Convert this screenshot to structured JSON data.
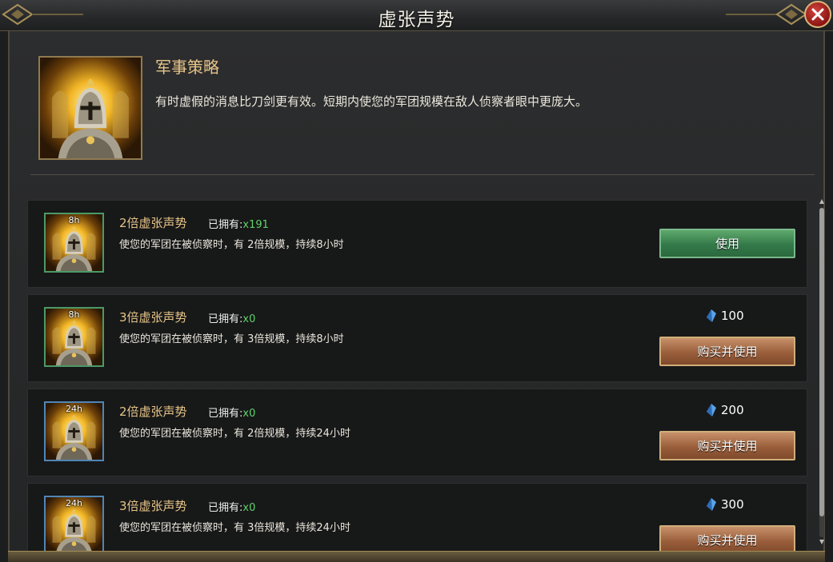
{
  "window": {
    "title": "虚张声势",
    "close_icon": "close-icon"
  },
  "header": {
    "title": "军事策略",
    "description": "有时虚假的消息比刀剑更有效。短期内使您的军团规模在敌人侦察者眼中更庞大。",
    "portrait_icon": "golden-knight-icon"
  },
  "items": [
    {
      "duration": "8h",
      "name": "2倍虚张声势",
      "owned_label": "已拥有:",
      "owned_count": "x191",
      "description": "使您的军团在被侦察时，有 2倍规模，持续8小时",
      "button": "使用"
    },
    {
      "duration": "8h",
      "name": "3倍虚张声势",
      "owned_label": "已拥有:",
      "owned_count": "x0",
      "description": "使您的军团在被侦察时，有 3倍规模，持续8小时",
      "price": "100",
      "button": "购买并使用"
    },
    {
      "duration": "24h",
      "name": "2倍虚张声势",
      "owned_label": "已拥有:",
      "owned_count": "x0",
      "description": "使您的军团在被侦察时，有 2倍规模，持续24小时",
      "price": "200",
      "button": "购买并使用"
    },
    {
      "duration": "24h",
      "name": "3倍虚张声势",
      "owned_label": "已拥有:",
      "owned_count": "x0",
      "description": "使您的军团在被侦察时，有 3倍规模，持续24小时",
      "price": "300",
      "button": "购买并使用"
    }
  ],
  "colors": {
    "gold_text": "#e6c488",
    "owned_count": "#5fd36a",
    "use_button": "#34794a",
    "buy_button": "#9a5e3b"
  }
}
